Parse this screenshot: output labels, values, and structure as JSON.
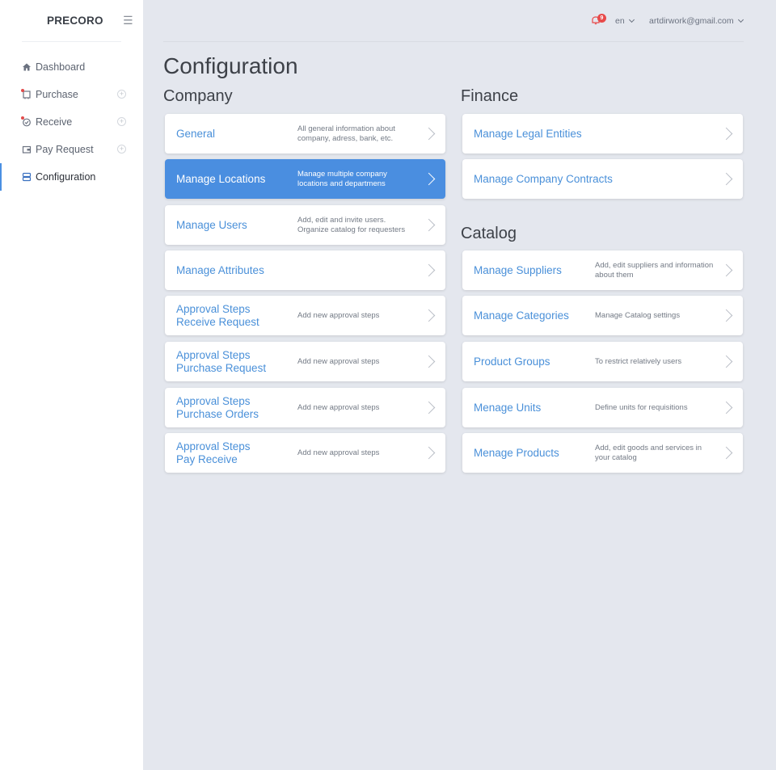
{
  "sidebar": {
    "brand": "PRECORO",
    "items": [
      {
        "label": "Dashboard",
        "icon": "home-icon"
      },
      {
        "label": "Purchase",
        "icon": "cart-icon"
      },
      {
        "label": "Receive",
        "icon": "receive-icon"
      },
      {
        "label": "Pay Request",
        "icon": "wallet-icon"
      },
      {
        "label": "Configuration",
        "icon": "server-icon"
      }
    ]
  },
  "topbar": {
    "notifications": "9",
    "language": "en",
    "user_email": "artdirwork@gmail.com"
  },
  "page": {
    "title": "Configuration",
    "company_title": "Company",
    "finance_title": "Finance",
    "catalog_title": "Catalog"
  },
  "company_cards": [
    {
      "title": "General",
      "desc": "All general information about company, adress, bank, etc."
    },
    {
      "title": "Manage Locations",
      "desc": "Manage multiple company locations and departmens"
    },
    {
      "title": "Manage Users",
      "desc": "Add, edit and invite users. Organize catalog for requesters"
    },
    {
      "title": "Manage Attributes",
      "desc": ""
    },
    {
      "title": "Approval Steps\nReceive Request",
      "desc": "Add new approval steps"
    },
    {
      "title": "Approval Steps\nPurchase Request",
      "desc": "Add new approval steps"
    },
    {
      "title": "Approval Steps\nPurchase Orders",
      "desc": "Add new approval steps"
    },
    {
      "title": "Approval Steps\nPay Receive",
      "desc": "Add new approval steps"
    }
  ],
  "finance_cards": [
    {
      "title": "Manage Legal Entities"
    },
    {
      "title": "Manage Company Contracts"
    }
  ],
  "catalog_cards": [
    {
      "title": "Manage Suppliers",
      "desc": "Add, edit suppliers and information about them"
    },
    {
      "title": "Manage Categories",
      "desc": "Manage Catalog settings"
    },
    {
      "title": "Product Groups",
      "desc": "To restrict relatively users"
    },
    {
      "title": "Menage Units",
      "desc": "Define units for requisitions"
    },
    {
      "title": "Menage Products",
      "desc": "Add, edit goods and services in your catalog"
    }
  ],
  "colors": {
    "accent": "#4a8ee0",
    "link": "#4a90d9",
    "badge": "#e84a4a",
    "background": "#e4e7ee"
  }
}
